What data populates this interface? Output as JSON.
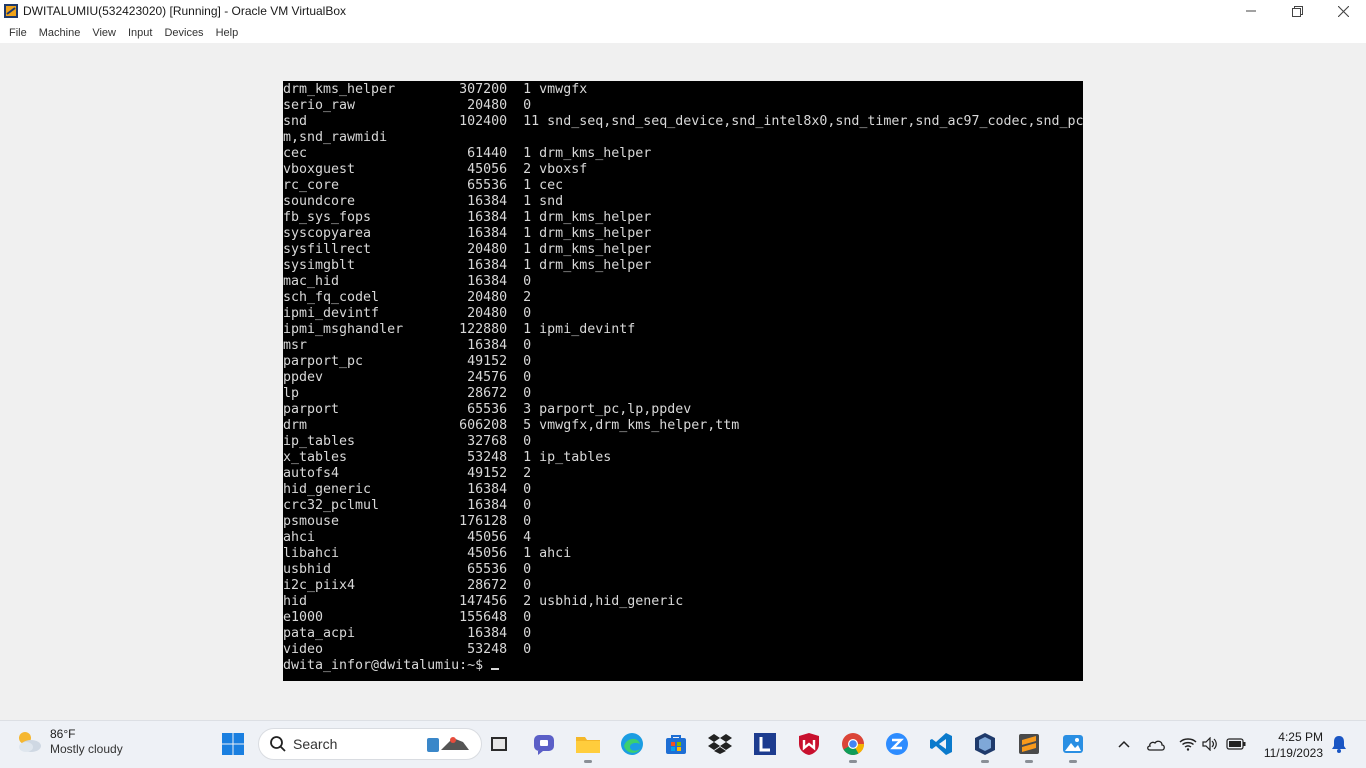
{
  "window": {
    "title": "DWITALUMIU(532423020) [Running] - Oracle VM VirtualBox",
    "controls": [
      "minimize-icon",
      "restore-icon",
      "close-icon"
    ]
  },
  "menu": [
    "File",
    "Machine",
    "View",
    "Input",
    "Devices",
    "Help"
  ],
  "terminal": {
    "lines": [
      "drm_kms_helper        307200  1 vmwgfx",
      "serio_raw              20480  0",
      "snd                   102400  11 snd_seq,snd_seq_device,snd_intel8x0,snd_timer,snd_ac97_codec,snd_pc",
      "m,snd_rawmidi",
      "cec                    61440  1 drm_kms_helper",
      "vboxguest              45056  2 vboxsf",
      "rc_core                65536  1 cec",
      "soundcore              16384  1 snd",
      "fb_sys_fops            16384  1 drm_kms_helper",
      "syscopyarea            16384  1 drm_kms_helper",
      "sysfillrect            20480  1 drm_kms_helper",
      "sysimgblt              16384  1 drm_kms_helper",
      "mac_hid                16384  0",
      "sch_fq_codel           20480  2",
      "ipmi_devintf           20480  0",
      "ipmi_msghandler       122880  1 ipmi_devintf",
      "msr                    16384  0",
      "parport_pc             49152  0",
      "ppdev                  24576  0",
      "lp                     28672  0",
      "parport                65536  3 parport_pc,lp,ppdev",
      "drm                   606208  5 vmwgfx,drm_kms_helper,ttm",
      "ip_tables              32768  0",
      "x_tables               53248  1 ip_tables",
      "autofs4                49152  2",
      "hid_generic            16384  0",
      "crc32_pclmul           16384  0",
      "psmouse               176128  0",
      "ahci                   45056  4",
      "libahci                45056  1 ahci",
      "usbhid                 65536  0",
      "i2c_piix4              28672  0",
      "hid                   147456  2 usbhid,hid_generic",
      "e1000                 155648  0",
      "pata_acpi              16384  0",
      "video                  53248  0"
    ],
    "prompt": "dwita_infor@dwitalumiu:~$ "
  },
  "taskbar": {
    "weather": {
      "temp": "86°F",
      "desc": "Mostly cloudy"
    },
    "search_placeholder": "Search",
    "clock": {
      "time": "4:25 PM",
      "date": "11/19/2023"
    },
    "pinned": [
      "windows-start-icon",
      "search-box",
      "task-view-icon",
      "teams-chat-icon",
      "file-explorer-icon",
      "edge-icon",
      "microsoft-store-icon",
      "dropbox-icon",
      "l-app-icon",
      "mcafee-icon",
      "chrome-icon",
      "zoom-icon",
      "vscode-icon",
      "virtualbox-icon",
      "sublime-icon",
      "photos-icon"
    ],
    "tray": [
      "chevron-up-icon",
      "onedrive-icon",
      "wifi-icon",
      "volume-icon",
      "battery-icon",
      "notification-bell-icon"
    ]
  }
}
